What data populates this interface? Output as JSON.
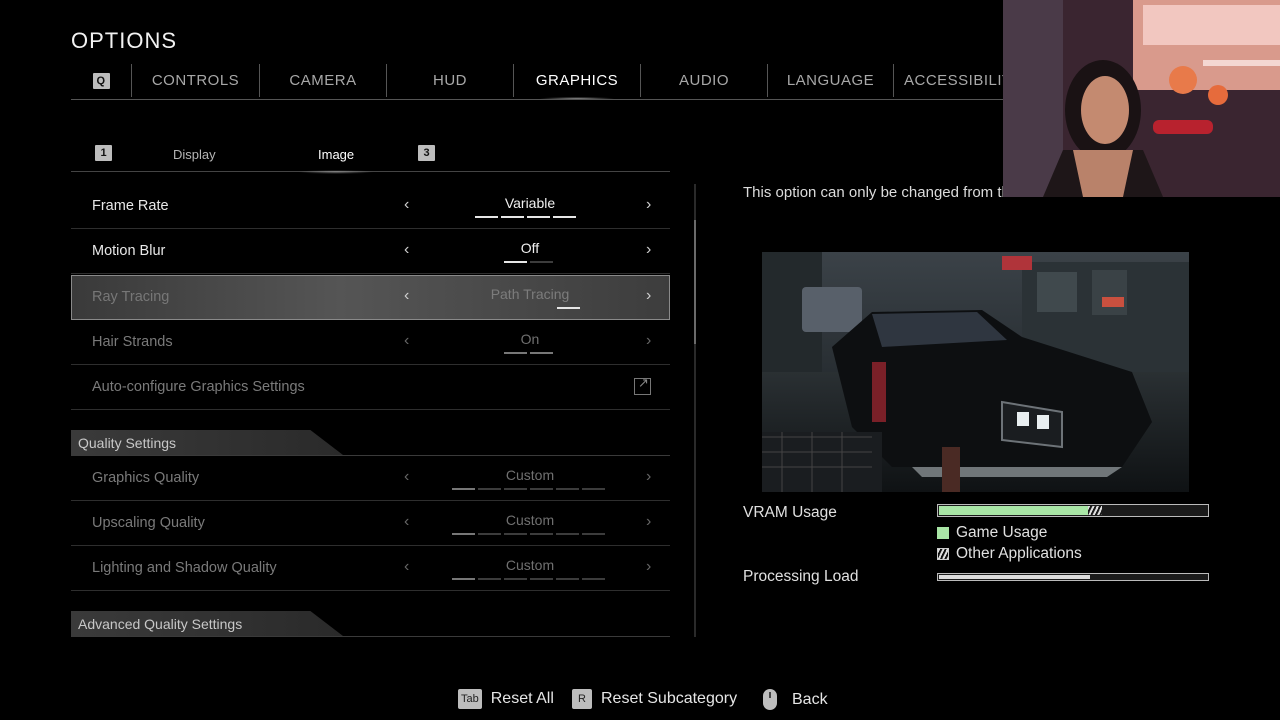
{
  "title": "OPTIONS",
  "top_tabs": {
    "prev_key": "Q",
    "items": [
      "CONTROLS",
      "CAMERA",
      "HUD",
      "GRAPHICS",
      "AUDIO",
      "LANGUAGE",
      "ACCESSIBILITY"
    ],
    "active": "GRAPHICS"
  },
  "sub_tabs": {
    "prev_key": "1",
    "items": [
      "Display",
      "Image"
    ],
    "active": "Image",
    "next_key": "3"
  },
  "settings": {
    "frame_rate": {
      "label": "Frame Rate",
      "value": "Variable",
      "level": 4,
      "levels": 4
    },
    "motion_blur": {
      "label": "Motion Blur",
      "value": "Off",
      "level": 1,
      "levels": 2
    },
    "ray_tracing": {
      "label": "Ray Tracing",
      "value": "Path Tracing",
      "level": 1,
      "levels": 1
    },
    "hair_strands": {
      "label": "Hair Strands",
      "value": "On",
      "level": 2,
      "levels": 2
    },
    "auto_configure": {
      "label": "Auto-configure Graphics Settings"
    },
    "quality_section": "Quality Settings",
    "graphics_quality": {
      "label": "Graphics Quality",
      "value": "Custom",
      "level": 1,
      "levels": 6
    },
    "upscaling_quality": {
      "label": "Upscaling Quality",
      "value": "Custom",
      "level": 1,
      "levels": 6
    },
    "lighting_shadow_quality": {
      "label": "Lighting and Shadow Quality",
      "value": "Custom",
      "level": 1,
      "levels": 6
    },
    "advanced_section": "Advanced Quality Settings"
  },
  "info_text": "This option can only be changed from the main menu.",
  "usage": {
    "vram_label": "VRAM Usage",
    "vram_game_fraction": 0.55,
    "vram_other_fraction": 0.05,
    "legend_game": "Game Usage",
    "legend_other": "Other Applications",
    "processing_label": "Processing Load",
    "processing_fraction": 0.56,
    "game_color": "#a9e6a6"
  },
  "footer": {
    "reset_all_key": "Tab",
    "reset_all": "Reset All",
    "reset_sub_key": "R",
    "reset_sub": "Reset Subcategory",
    "back": "Back"
  }
}
